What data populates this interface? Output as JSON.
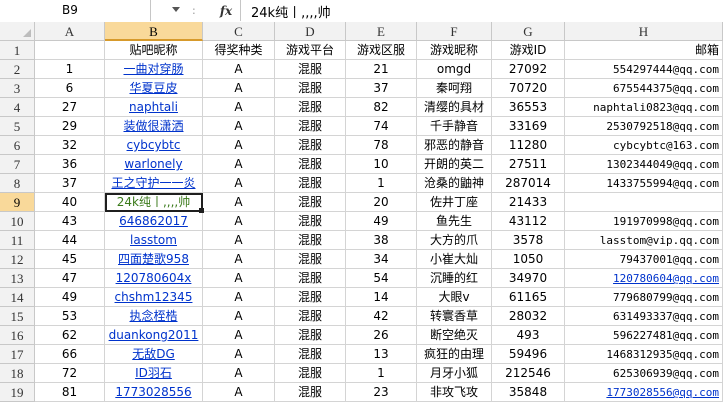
{
  "name_box": "B9",
  "fx_label": "fx",
  "separator": ":",
  "formula": "24k纯丨,,,,帅",
  "columns": [
    "A",
    "B",
    "C",
    "D",
    "E",
    "F",
    "G",
    "H"
  ],
  "selected_col": "B",
  "rows": [
    {
      "num": "1",
      "cells": [
        "",
        "贴吧昵称",
        "得奖种类",
        "游戏平台",
        "游戏区服",
        "游戏昵称",
        "游戏ID",
        "邮箱"
      ]
    },
    {
      "num": "2",
      "cells": [
        "1",
        "一曲对穿肠",
        "A",
        "混服",
        "21",
        "omgd",
        "27092",
        "554297444@qq.com"
      ]
    },
    {
      "num": "3",
      "cells": [
        "6",
        "华夏豆皮",
        "A",
        "混服",
        "37",
        "秦呵翔",
        "70720",
        "675544375@qq.com"
      ]
    },
    {
      "num": "4",
      "cells": [
        "27",
        "naphtali",
        "A",
        "混服",
        "82",
        "清缨的具材",
        "36553",
        "naphtali0823@qq.com"
      ]
    },
    {
      "num": "5",
      "cells": [
        "29",
        "装做很潇洒",
        "A",
        "混服",
        "74",
        "千手静音",
        "33169",
        "2530792518@qq.com"
      ]
    },
    {
      "num": "6",
      "cells": [
        "32",
        "cybcybtc",
        "A",
        "混服",
        "78",
        "邪恶的静音",
        "11280",
        "cybcybtc@163.com"
      ]
    },
    {
      "num": "7",
      "cells": [
        "36",
        "warlonely",
        "A",
        "混服",
        "10",
        "开朗的英二",
        "27511",
        "1302344049@qq.com"
      ]
    },
    {
      "num": "8",
      "cells": [
        "37",
        "王之守护一一炎",
        "A",
        "混服",
        "1",
        "沧桑的鼬神",
        "287014",
        "1433755994@qq.com"
      ]
    },
    {
      "num": "9",
      "cells": [
        "40",
        "24k纯丨,,,,帅",
        "A",
        "混服",
        "20",
        "佐井丁座",
        "21433",
        ""
      ]
    },
    {
      "num": "10",
      "cells": [
        "43",
        "646862017",
        "A",
        "混服",
        "49",
        "鱼先生",
        "43112",
        "191970998@qq.com"
      ]
    },
    {
      "num": "11",
      "cells": [
        "44",
        "lasstom",
        "A",
        "混服",
        "38",
        "大方的爪",
        "3578",
        "lasstom@vip.qq.com"
      ]
    },
    {
      "num": "12",
      "cells": [
        "45",
        "四面楚歌958",
        "A",
        "混服",
        "34",
        "小崔大灿",
        "1050",
        "79437001@qq.com"
      ]
    },
    {
      "num": "13",
      "cells": [
        "47",
        "120780604x",
        "A",
        "混服",
        "54",
        "沉睡的红",
        "34970",
        "120780604@qq.com"
      ]
    },
    {
      "num": "14",
      "cells": [
        "49",
        "chshm12345",
        "A",
        "混服",
        "14",
        "大眼v",
        "61165",
        "779680799@qq.com"
      ]
    },
    {
      "num": "15",
      "cells": [
        "53",
        "执念桎梏",
        "A",
        "混服",
        "42",
        "转寰香草",
        "28032",
        "631493337@qq.com"
      ]
    },
    {
      "num": "16",
      "cells": [
        "62",
        "duankong2011",
        "A",
        "混服",
        "26",
        "断空绝灭",
        "493",
        "596227481@qq.com"
      ]
    },
    {
      "num": "17",
      "cells": [
        "66",
        "无敌DG",
        "A",
        "混服",
        "13",
        "疯狂的由理",
        "59496",
        "1468312935@qq.com"
      ]
    },
    {
      "num": "18",
      "cells": [
        "72",
        "ID羽石",
        "A",
        "混服",
        "1",
        "月牙小狐",
        "212546",
        "625306939@qq.com"
      ]
    },
    {
      "num": "19",
      "cells": [
        "81",
        "1773028556",
        "A",
        "混服",
        "23",
        "非攻飞攻",
        "35848",
        "1773028556@qq.com"
      ]
    }
  ],
  "link_b_rows": [
    2,
    3,
    4,
    5,
    6,
    7,
    8,
    10,
    11,
    12,
    13,
    14,
    15,
    16,
    17,
    18,
    19
  ],
  "link_h_rows": [
    13,
    19
  ],
  "active_cell": {
    "row": 9,
    "col": "B"
  }
}
